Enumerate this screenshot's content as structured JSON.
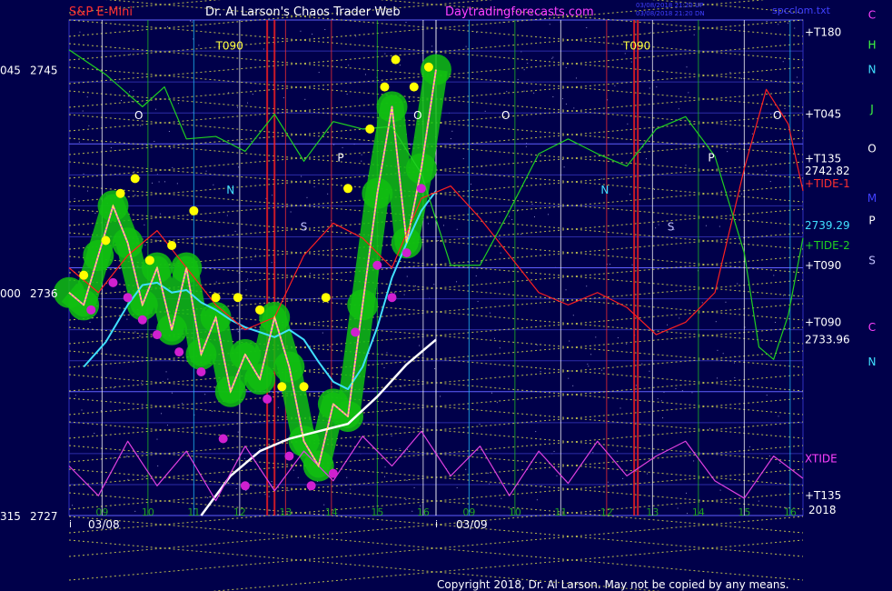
{
  "header": {
    "instrument": "S&P E-Mini",
    "publisher": "Dr. Al Larson's Chaos Trader Web",
    "site": "Daytradingforecasts.com",
    "stamp1": "03/08/2018 21:20 UP",
    "stamp2": "03/08/2018 21:20 DN",
    "filename": "spcclom.txt"
  },
  "footer": {
    "copyright": "Copyright 2018, Dr. Al Larson. May not be copied by any means."
  },
  "colors": {
    "background": "#00004a",
    "price_bar": "#ffff40",
    "price_line": "#ff40ff",
    "halo": "#10c010",
    "ma_fast": "#40e0ff",
    "ma_slow": "#ffffff",
    "tide_1": "#ff2020",
    "tide_2": "#20d020",
    "xtide": "#e040e0",
    "grid_diag": "#e8e850",
    "title_red": "#ff3030",
    "title_white": "#ffffff",
    "title_magenta": "#ff40ff"
  },
  "chart_data": {
    "type": "line",
    "title": "S&P E-Mini",
    "xlabel": "",
    "ylabel": "",
    "ylim": [
      2727,
      2747
    ],
    "y_ticks": [
      {
        "value": 2745,
        "label": "2745",
        "left_label": "045"
      },
      {
        "value": 2736,
        "label": "2736",
        "left_label": "000"
      },
      {
        "value": 2727,
        "label": "2727",
        "left_label": "315"
      }
    ],
    "x_ticks": [
      "09",
      "10",
      "11",
      "12",
      "13",
      "14",
      "15",
      "16",
      "09",
      "10",
      "11",
      "12",
      "13",
      "14",
      "15",
      "16"
    ],
    "session_start_markers": [
      "i",
      "i"
    ],
    "date_labels": [
      "03/08",
      "03/09"
    ],
    "extra_axis_label": "2018",
    "right_labels": [
      {
        "text": "+T180",
        "y": 2746.5
      },
      {
        "text": "+T045",
        "y": 2743.2
      },
      {
        "text": "+T135",
        "y": 2741.4
      },
      {
        "text": "2742.82",
        "y": 2740.9
      },
      {
        "text": "+TIDE-1",
        "y": 2740.4
      },
      {
        "text": "2739.29",
        "y": 2738.7
      },
      {
        "text": "+TIDE-2",
        "y": 2737.9
      },
      {
        "text": "+T090",
        "y": 2737.1
      },
      {
        "text": "+T090",
        "y": 2734.8
      },
      {
        "text": "2733.96",
        "y": 2734.1
      },
      {
        "text": "XTIDE",
        "y": 2729.3
      },
      {
        "text": "+T135",
        "y": 2727.8
      }
    ],
    "far_right_letters": [
      {
        "text": "C",
        "color": "#ff40ff",
        "y": 2747.2
      },
      {
        "text": "C",
        "color": "#ff40ff",
        "y": 2734.6
      },
      {
        "text": "H",
        "color": "#40ff40",
        "y": 2746.0
      },
      {
        "text": "N",
        "color": "#40e0ff",
        "y": 2745.0
      },
      {
        "text": "J",
        "color": "#40ff40",
        "y": 2743.4
      },
      {
        "text": "O",
        "color": "#ffffff",
        "y": 2741.8
      },
      {
        "text": "M",
        "color": "#4040ff",
        "y": 2739.8
      },
      {
        "text": "P",
        "color": "#ffffff",
        "y": 2738.9
      },
      {
        "text": "S",
        "color": "#c0c0ff",
        "y": 2737.3
      },
      {
        "text": "N",
        "color": "#40e0ff",
        "y": 2733.2
      }
    ],
    "time_markers": [
      {
        "text": "T090",
        "x": 0.2,
        "y": 2745.8
      },
      {
        "text": "T090",
        "x": 0.755,
        "y": 2745.8
      }
    ],
    "plot_letters": [
      {
        "text": "O",
        "x": 0.095,
        "y": 2743,
        "color": "#ffffff"
      },
      {
        "text": "N",
        "x": 0.22,
        "y": 2740,
        "color": "#40e0ff"
      },
      {
        "text": "P",
        "x": 0.37,
        "y": 2741.3,
        "color": "#ffffff"
      },
      {
        "text": "S",
        "x": 0.32,
        "y": 2738.5,
        "color": "#c0c0ff"
      },
      {
        "text": "O",
        "x": 0.475,
        "y": 2743,
        "color": "#ffffff"
      },
      {
        "text": "O",
        "x": 0.595,
        "y": 2743,
        "color": "#ffffff"
      },
      {
        "text": "N",
        "x": 0.73,
        "y": 2740,
        "color": "#40e0ff"
      },
      {
        "text": "S",
        "x": 0.82,
        "y": 2738.5,
        "color": "#c0c0ff"
      },
      {
        "text": "P",
        "x": 0.875,
        "y": 2741.3,
        "color": "#ffffff"
      },
      {
        "text": "O",
        "x": 0.965,
        "y": 2743,
        "color": "#ffffff"
      }
    ],
    "series": [
      {
        "name": "",
        "role": "price",
        "x": [
          0.0,
          0.02,
          0.04,
          0.06,
          0.08,
          0.1,
          0.12,
          0.14,
          0.16,
          0.18,
          0.2,
          0.22,
          0.24,
          0.26,
          0.28,
          0.3,
          0.32,
          0.34,
          0.36,
          0.38,
          0.4,
          0.42,
          0.44,
          0.46,
          0.48,
          0.5
        ],
        "values": [
          2736,
          2735.5,
          2737.5,
          2739.5,
          2738,
          2735.5,
          2737,
          2734.5,
          2737,
          2733.5,
          2735,
          2732,
          2733.5,
          2732.5,
          2735,
          2733,
          2730,
          2729,
          2731.5,
          2731,
          2735.5,
          2740,
          2743.5,
          2738,
          2741,
          2745
        ]
      },
      {
        "name": "",
        "role": "fast average",
        "x": [
          0.02,
          0.05,
          0.08,
          0.1,
          0.12,
          0.14,
          0.16,
          0.18,
          0.2,
          0.22,
          0.24,
          0.26,
          0.28,
          0.3,
          0.32,
          0.34,
          0.36,
          0.38,
          0.4,
          0.42,
          0.44,
          0.46,
          0.48,
          0.5
        ],
        "values": [
          2733,
          2734,
          2735.5,
          2736.3,
          2736.4,
          2736,
          2736.1,
          2735.6,
          2735.3,
          2734.9,
          2734.6,
          2734.4,
          2734.2,
          2734.5,
          2734.1,
          2733.2,
          2732.4,
          2732.1,
          2733,
          2734.6,
          2736.6,
          2738,
          2739.3,
          2740.1
        ]
      },
      {
        "name": "",
        "role": "slow average",
        "x": [
          0.18,
          0.22,
          0.26,
          0.3,
          0.34,
          0.38,
          0.42,
          0.46,
          0.5
        ],
        "values": [
          2727,
          2728.6,
          2729.6,
          2730.1,
          2730.4,
          2730.7,
          2731.8,
          2733.1,
          2734.1
        ]
      },
      {
        "name": "TIDE-1",
        "x": [
          0.0,
          0.04,
          0.08,
          0.12,
          0.16,
          0.2,
          0.24,
          0.28,
          0.32,
          0.36,
          0.4,
          0.44,
          0.48,
          0.52,
          0.56,
          0.6,
          0.64,
          0.68,
          0.72,
          0.76,
          0.8,
          0.84,
          0.88,
          0.92,
          0.95,
          0.98,
          1.0
        ],
        "values": [
          2737,
          2736,
          2737.5,
          2738.5,
          2737,
          2735.5,
          2734.5,
          2735,
          2737.5,
          2738.8,
          2738.2,
          2737,
          2739.8,
          2740.3,
          2739,
          2737.5,
          2736,
          2735.5,
          2736,
          2735.4,
          2734.3,
          2734.8,
          2736,
          2741,
          2744.2,
          2742.8,
          2740.1
        ]
      },
      {
        "name": "TIDE-2",
        "x": [
          0.0,
          0.05,
          0.1,
          0.13,
          0.16,
          0.2,
          0.24,
          0.28,
          0.32,
          0.36,
          0.4,
          0.44,
          0.48,
          0.52,
          0.56,
          0.6,
          0.64,
          0.68,
          0.72,
          0.76,
          0.8,
          0.84,
          0.88,
          0.92,
          0.94,
          0.96,
          0.98,
          1.0
        ],
        "values": [
          2745.8,
          2744.8,
          2743.5,
          2744.3,
          2742.2,
          2742.3,
          2741.7,
          2743.2,
          2741.3,
          2742.9,
          2742.6,
          2742.7,
          2740.8,
          2737.1,
          2737.1,
          2739.3,
          2741.6,
          2742.2,
          2741.6,
          2741.1,
          2742.6,
          2743.1,
          2741.5,
          2737.6,
          2733.8,
          2733.3,
          2735.1,
          2738.2
        ]
      },
      {
        "name": "XTIDE",
        "x": [
          0.0,
          0.04,
          0.08,
          0.12,
          0.16,
          0.2,
          0.24,
          0.28,
          0.32,
          0.36,
          0.4,
          0.44,
          0.48,
          0.52,
          0.56,
          0.6,
          0.64,
          0.68,
          0.72,
          0.76,
          0.8,
          0.84,
          0.88,
          0.92,
          0.96,
          1.0
        ],
        "values": [
          2729,
          2727.8,
          2730,
          2728.2,
          2729.6,
          2727.6,
          2729.8,
          2728,
          2729.6,
          2728.4,
          2730.2,
          2729,
          2730.4,
          2728.6,
          2729.8,
          2727.8,
          2729.6,
          2728.3,
          2730,
          2728.6,
          2729.4,
          2730,
          2728.4,
          2727.7,
          2729.4,
          2728.5
        ]
      }
    ],
    "highs": {
      "x": [
        0.02,
        0.05,
        0.07,
        0.09,
        0.11,
        0.14,
        0.17,
        0.2,
        0.23,
        0.26,
        0.29,
        0.32,
        0.35,
        0.38,
        0.41,
        0.43,
        0.445,
        0.47,
        0.49
      ],
      "values": [
        2736.7,
        2738.1,
        2740,
        2740.6,
        2737.3,
        2737.9,
        2739.3,
        2735.8,
        2735.8,
        2735.3,
        2732.2,
        2732.2,
        2735.8,
        2740.2,
        2742.6,
        2744.3,
        2745.4,
        2744.3,
        2745.1
      ]
    },
    "lows": {
      "x": [
        0.03,
        0.06,
        0.08,
        0.1,
        0.12,
        0.15,
        0.18,
        0.21,
        0.24,
        0.27,
        0.3,
        0.33,
        0.36,
        0.39,
        0.42,
        0.44,
        0.46,
        0.48
      ],
      "values": [
        2735.3,
        2736.4,
        2735.8,
        2734.9,
        2734.3,
        2733.6,
        2732.8,
        2730.1,
        2728.2,
        2731.7,
        2729.4,
        2728.2,
        2728.7,
        2734.4,
        2737.1,
        2735.8,
        2737.6,
        2740.2
      ]
    }
  }
}
